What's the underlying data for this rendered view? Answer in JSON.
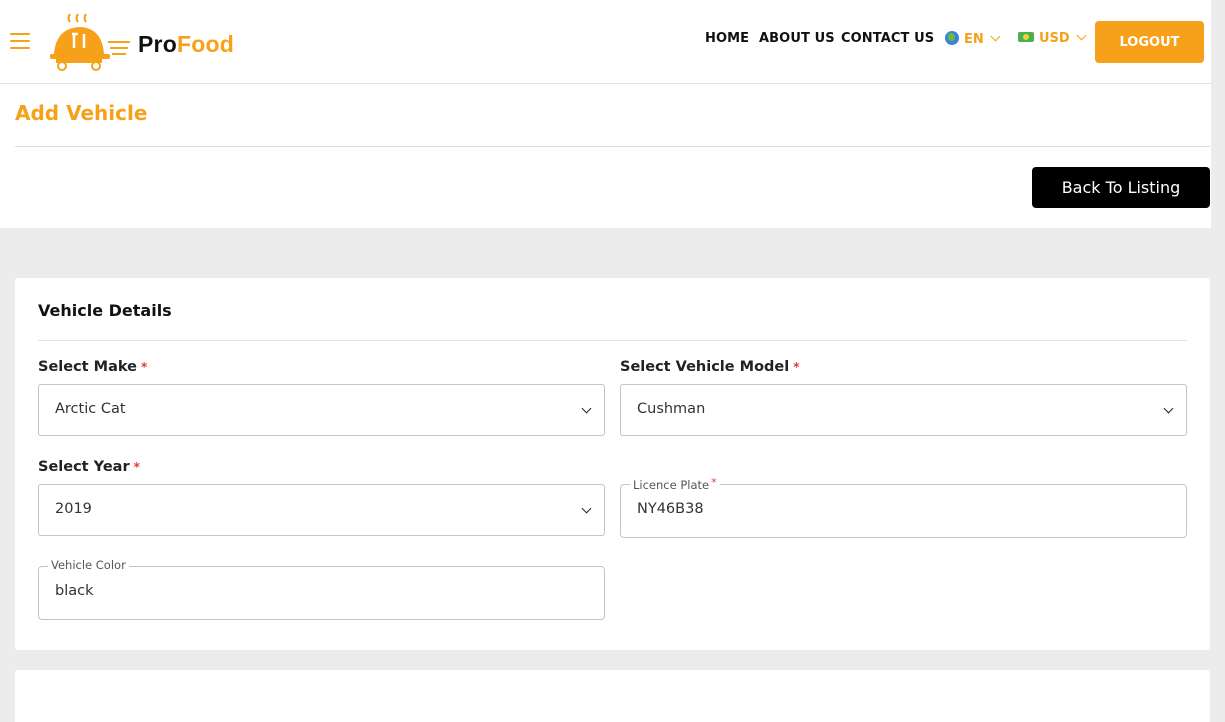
{
  "brand": {
    "name_part1": "Pro",
    "name_part2": "Food",
    "accent": "#f7a01a"
  },
  "header": {
    "nav": [
      "HOME",
      "ABOUT US",
      "CONTACT US"
    ],
    "language": "EN",
    "currency": "USD",
    "logout_label": "LOGOUT",
    "icons": [
      "hamburger-menu-icon",
      "globe-icon",
      "money-icon",
      "chevron-down-icon"
    ]
  },
  "page": {
    "title": "Add Vehicle",
    "back_label": "Back To Listing"
  },
  "form": {
    "section_title": "Vehicle Details",
    "make": {
      "label": "Select Make",
      "value": "Arctic Cat"
    },
    "model": {
      "label": "Select Vehicle Model",
      "value": "Cushman"
    },
    "year": {
      "label": "Select Year",
      "value": "2019"
    },
    "plate": {
      "label": "Licence Plate",
      "value": "NY46B38"
    },
    "color": {
      "label": "Vehicle Color",
      "value": "black"
    },
    "required_mark": "*"
  }
}
